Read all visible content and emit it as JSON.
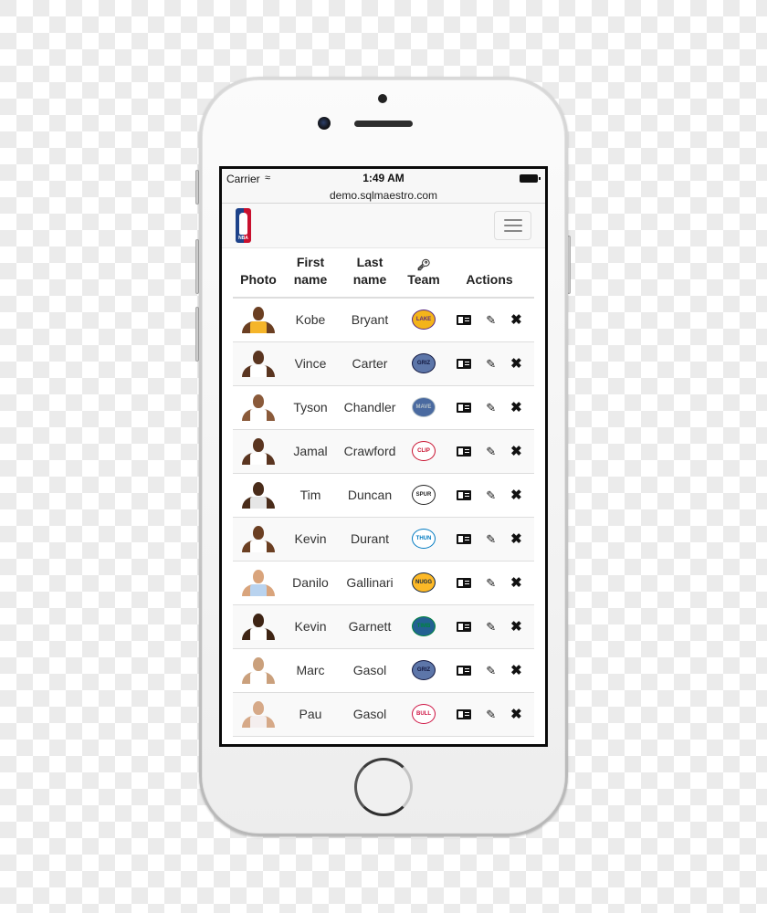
{
  "status_bar": {
    "carrier": "Carrier",
    "wifi_icon": "wifi-icon",
    "time": "1:49 AM",
    "battery_icon": "battery-icon"
  },
  "browser": {
    "url": "demo.sqlmaestro.com"
  },
  "navbar": {
    "logo": "NBA",
    "menu_icon": "hamburger-icon"
  },
  "table": {
    "headers": {
      "photo": "Photo",
      "first_name": "First name",
      "last_name": "Last name",
      "team_icon": "key-icon",
      "team": "Team",
      "actions": "Actions"
    },
    "rows": [
      {
        "first": "Kobe",
        "last": "Bryant",
        "team": "Lakers",
        "skin": "#6b3f22",
        "jersey": "#f5b52a",
        "logo_bg": "#f4b41a",
        "logo_fg": "#552583"
      },
      {
        "first": "Vince",
        "last": "Carter",
        "team": "Grizzlies",
        "skin": "#5a3520",
        "jersey": "#ffffff",
        "logo_bg": "#5d76a9",
        "logo_fg": "#12173f"
      },
      {
        "first": "Tyson",
        "last": "Chandler",
        "team": "Mavericks",
        "skin": "#8a5a3a",
        "jersey": "#ffffff",
        "logo_bg": "#4a6aa0",
        "logo_fg": "#b8c4ca"
      },
      {
        "first": "Jamal",
        "last": "Crawford",
        "team": "Clippers",
        "skin": "#5a3520",
        "jersey": "#ffffff",
        "logo_bg": "#ffffff",
        "logo_fg": "#c8102e"
      },
      {
        "first": "Tim",
        "last": "Duncan",
        "team": "Spurs",
        "skin": "#4a2c1a",
        "jersey": "#e6e6e6",
        "logo_bg": "#ffffff",
        "logo_fg": "#222222"
      },
      {
        "first": "Kevin",
        "last": "Durant",
        "team": "Thunder",
        "skin": "#6b3f22",
        "jersey": "#ffffff",
        "logo_bg": "#ffffff",
        "logo_fg": "#007ac1"
      },
      {
        "first": "Danilo",
        "last": "Gallinari",
        "team": "Nuggets",
        "skin": "#d9a47c",
        "jersey": "#b9d3ef",
        "logo_bg": "#fdb927",
        "logo_fg": "#0e2240"
      },
      {
        "first": "Kevin",
        "last": "Garnett",
        "team": "Timberwolves",
        "skin": "#3e2414",
        "jersey": "#ffffff",
        "logo_bg": "#236192",
        "logo_fg": "#00843d"
      },
      {
        "first": "Marc",
        "last": "Gasol",
        "team": "Grizzlies",
        "skin": "#caa07c",
        "jersey": "#ffffff",
        "logo_bg": "#5d76a9",
        "logo_fg": "#12173f"
      },
      {
        "first": "Pau",
        "last": "Gasol",
        "team": "Bulls",
        "skin": "#d6a988",
        "jersey": "#f4eeee",
        "logo_bg": "#ffffff",
        "logo_fg": "#ce1141"
      }
    ],
    "action_icons": [
      "view-card-icon",
      "pencil-icon",
      "close-icon"
    ]
  },
  "colors": {
    "row_stripe": "#f9f9f9",
    "border": "#dddddd",
    "navbar_bg": "#f8f8f8"
  }
}
